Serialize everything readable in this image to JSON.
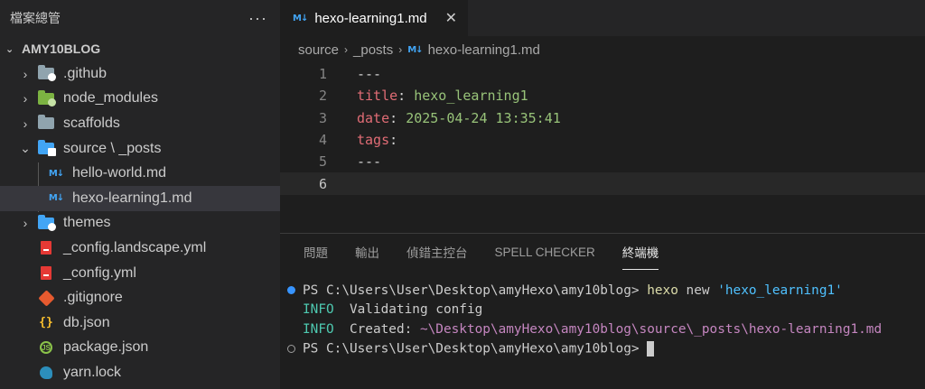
{
  "sidebar": {
    "title": "檔案總管",
    "more": "···",
    "root": "AMY10BLOG",
    "items": [
      {
        "label": ".github",
        "chevron": "›"
      },
      {
        "label": "node_modules",
        "chevron": "›"
      },
      {
        "label": "scaffolds",
        "chevron": "›"
      },
      {
        "label": "source \\ _posts",
        "chevron": "⌄"
      },
      {
        "label": "hello-world.md"
      },
      {
        "label": "hexo-learning1.md"
      },
      {
        "label": "themes",
        "chevron": "›"
      },
      {
        "label": "_config.landscape.yml"
      },
      {
        "label": "_config.yml"
      },
      {
        "label": ".gitignore"
      },
      {
        "label": "db.json"
      },
      {
        "label": "package.json"
      },
      {
        "label": "yarn.lock"
      }
    ]
  },
  "icons": {
    "md": "M↓",
    "json": "{}",
    "js": "JS"
  },
  "editor": {
    "tab": {
      "label": "hexo-learning1.md",
      "close": "✕"
    },
    "breadcrumb": [
      "source",
      "_posts",
      "hexo-learning1.md"
    ],
    "breadcrumb_sep": "›",
    "lines": [
      {
        "num": "1",
        "text": "---"
      },
      {
        "num": "2",
        "key": "title",
        "colon": ": ",
        "value": "hexo_learning1"
      },
      {
        "num": "3",
        "key": "date",
        "colon": ": ",
        "value": "2025-04-24 13:35:41"
      },
      {
        "num": "4",
        "key": "tags",
        "colon": ":"
      },
      {
        "num": "5",
        "text": "---"
      },
      {
        "num": "6",
        "text": ""
      }
    ]
  },
  "panel": {
    "tabs": [
      "問題",
      "輸出",
      "偵錯主控台",
      "SPELL CHECKER",
      "終端機"
    ],
    "active_tab": "終端機"
  },
  "terminal": {
    "line1": {
      "prompt": "PS C:\\Users\\User\\Desktop\\amyHexo\\amy10blog> ",
      "cmd": "hexo",
      "arg": " new ",
      "str": "'hexo_learning1'"
    },
    "line2": {
      "tag": "INFO",
      "text": "  Validating config"
    },
    "line3": {
      "tag": "INFO",
      "text": "  Created: ",
      "path": "~\\Desktop\\amyHexo\\amy10blog\\source\\_posts\\hexo-learning1.md"
    },
    "line4": {
      "prompt": "PS C:\\Users\\User\\Desktop\\amyHexo\\amy10blog> "
    }
  }
}
